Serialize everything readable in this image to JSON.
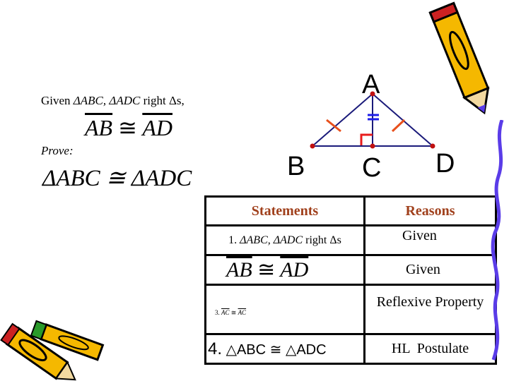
{
  "given": {
    "label": "Given",
    "triangles": "ΔABC, ΔADC",
    "suffix": "right Δs,",
    "seg1": "AB",
    "cong": "≅",
    "seg2": "AD"
  },
  "prove": {
    "label": "Prove:",
    "statement": "ΔABC ≅ ΔADC"
  },
  "diagram": {
    "labels": [
      "A",
      "B",
      "C",
      "D"
    ],
    "colors": {
      "lines": "#1a1a7a",
      "ticks": "#e8501c",
      "right_angle": "#e81c1c",
      "double_tick": "#1c1ce8",
      "points": "#c01010"
    }
  },
  "proof_table": {
    "headers": [
      "Statements",
      "Reasons"
    ],
    "header_color": "#a0401c",
    "rows": [
      {
        "num": "1.",
        "statement": "ΔABC, ΔADC",
        "statement_suffix": "right Δs",
        "reason": "Given"
      },
      {
        "seg1": "AB",
        "cong": "≅",
        "seg2": "AD",
        "reason": "Given"
      },
      {
        "num": "3.",
        "seg1": "AC",
        "cong": "≅",
        "seg2": "AC",
        "reason": "Reflexive Property"
      },
      {
        "num": "4.",
        "statement": "△ABC ≅ △ADC",
        "reason": "HL  Postulate"
      }
    ]
  }
}
